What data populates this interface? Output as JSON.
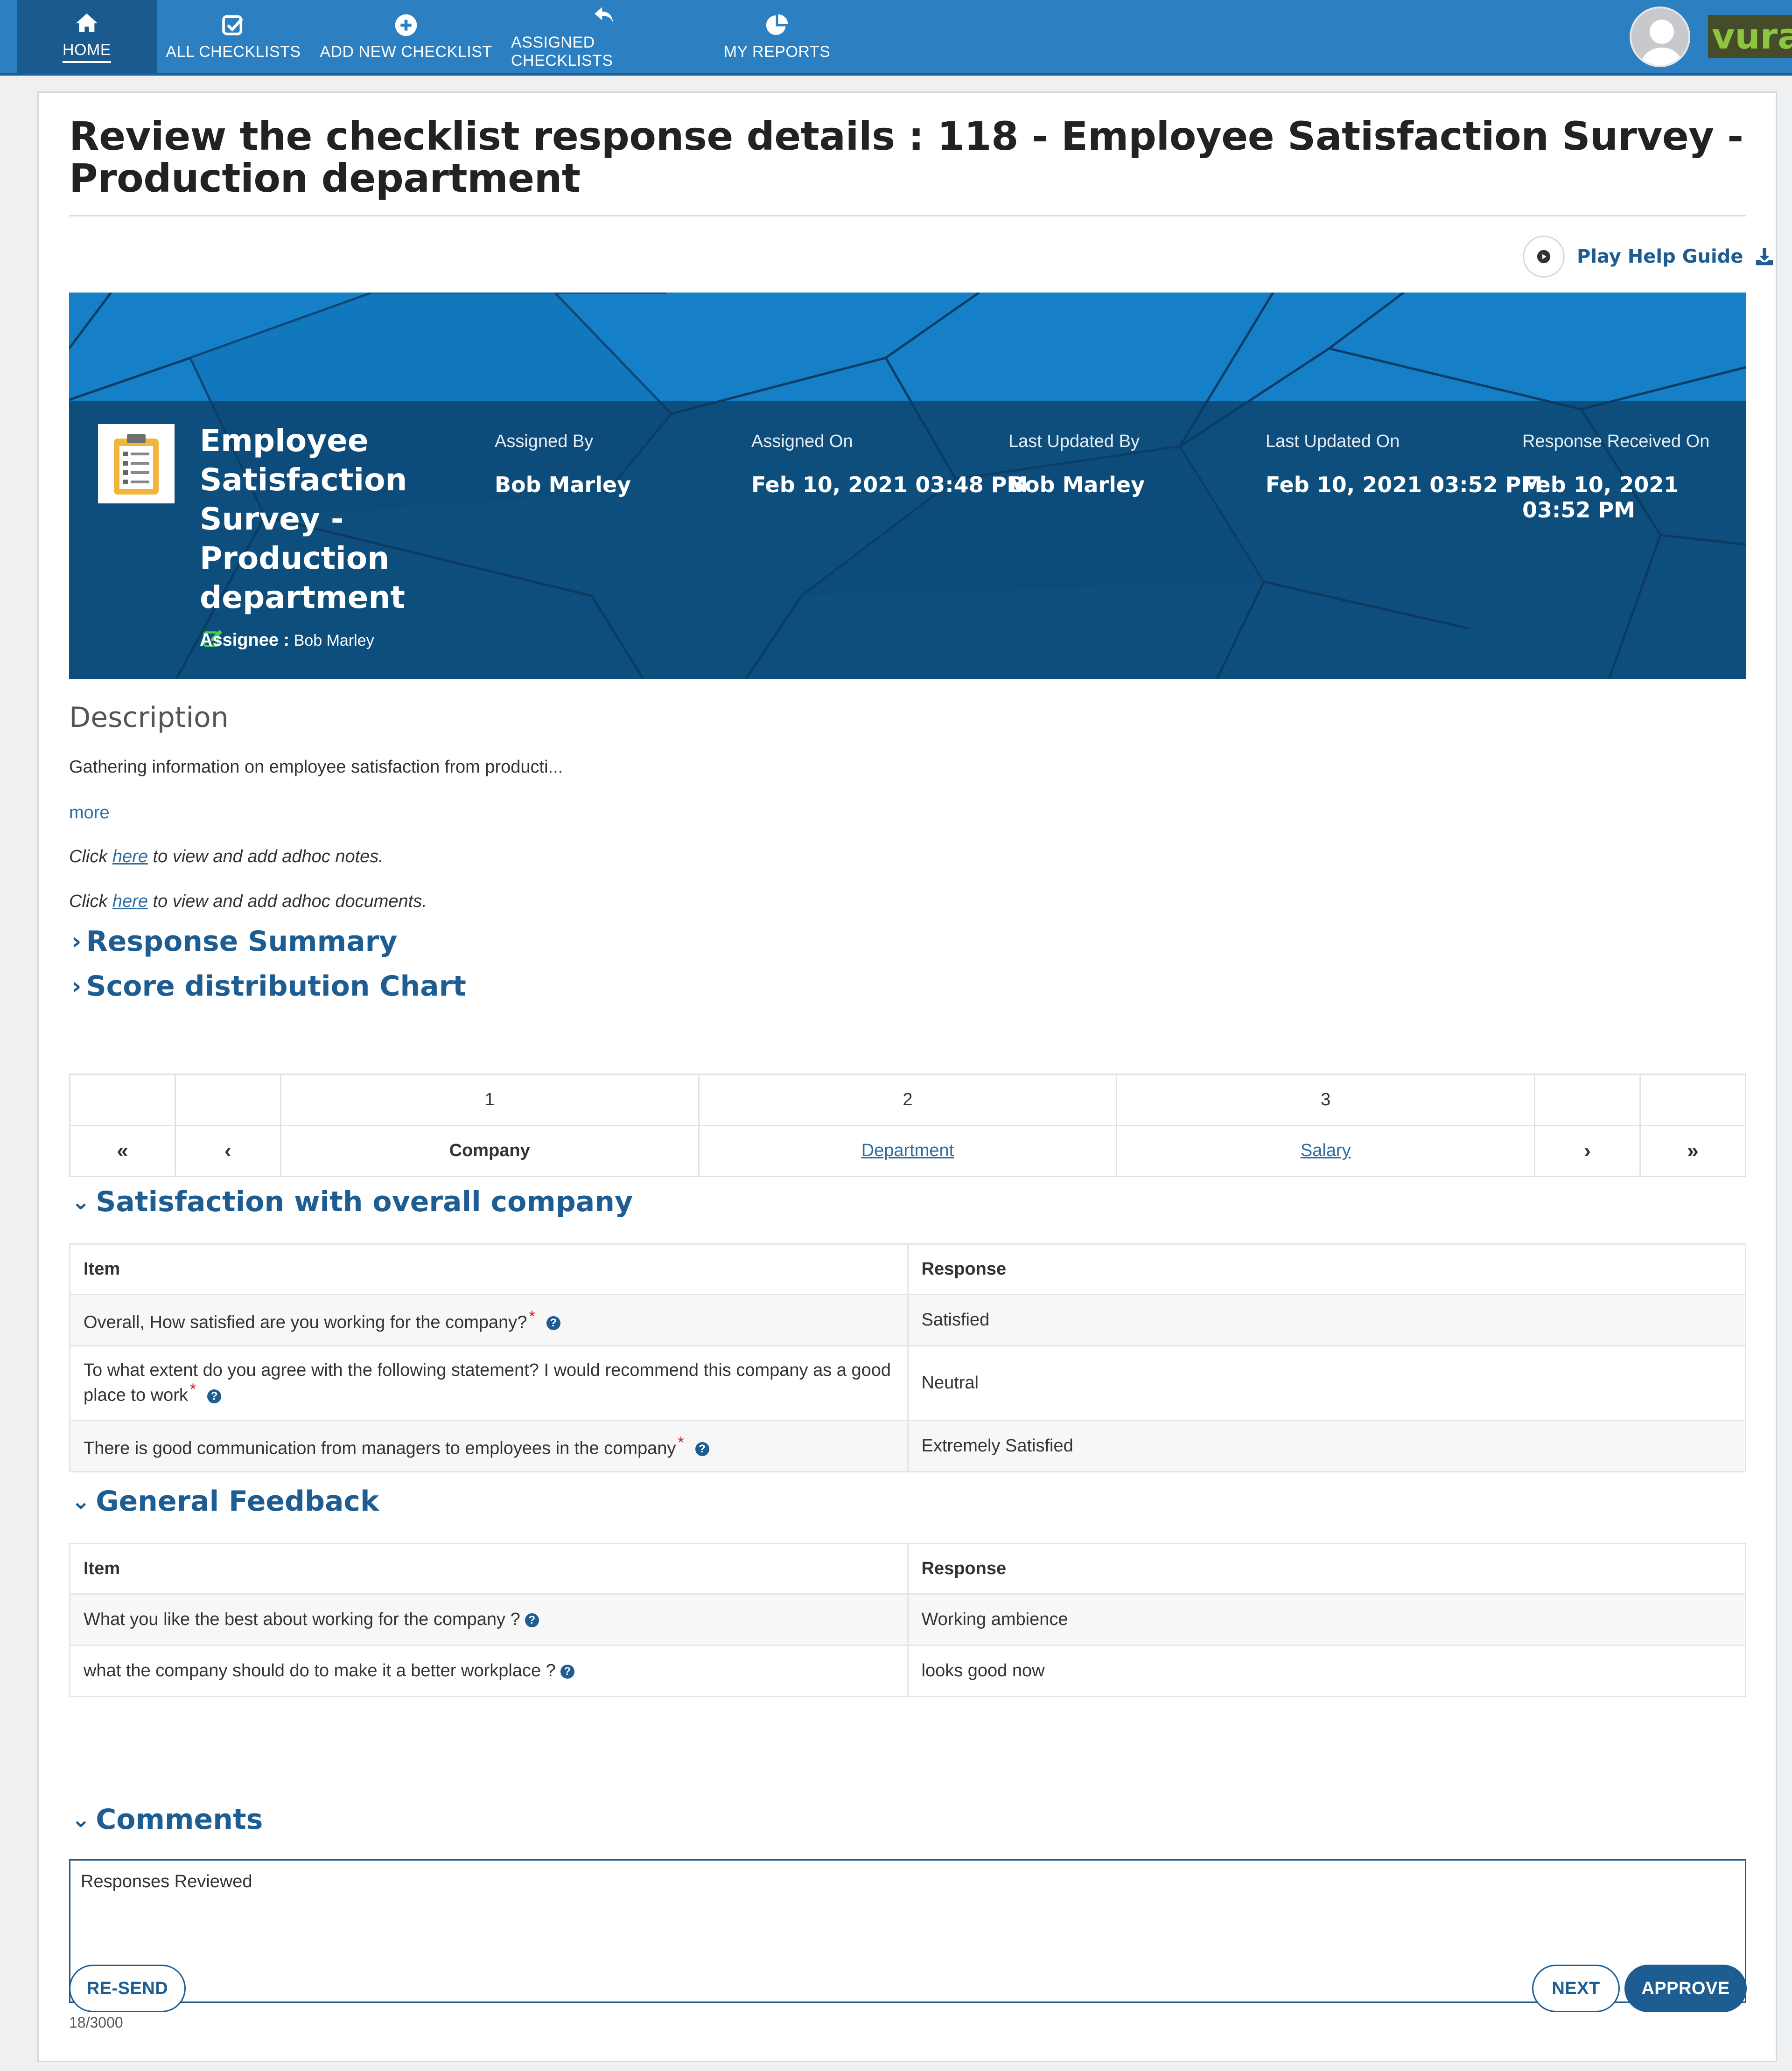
{
  "nav": {
    "items": [
      {
        "label": "HOME",
        "icon": "home-icon"
      },
      {
        "label": "ALL CHECKLISTS",
        "icon": "checkbox-icon"
      },
      {
        "label": "ADD NEW CHECKLIST",
        "icon": "plus-circle-icon"
      },
      {
        "label": "ASSIGNED CHECKLISTS",
        "icon": "reply-icon"
      },
      {
        "label": "MY REPORTS",
        "icon": "pie-chart-icon"
      }
    ],
    "logo_text": "vuram"
  },
  "page": {
    "title": "Review the checklist response details : 118 - Employee Satisfaction Survey - Production department",
    "help_guide": "Play Help Guide"
  },
  "banner": {
    "checklist_name": "Employee Satisfaction Survey - Production department",
    "assignee_label": "Assignee :",
    "assignee_value": "Bob Marley",
    "meta": [
      {
        "label": "Assigned By",
        "value": "Bob Marley"
      },
      {
        "label": "Assigned On",
        "value": "Feb 10, 2021 03:48 PM"
      },
      {
        "label": "Last Updated By",
        "value": "Bob Marley"
      },
      {
        "label": "Last Updated On",
        "value": "Feb 10, 2021 03:52 PM"
      },
      {
        "label": "Response Received On",
        "value": "Feb 10, 2021 03:52 PM"
      }
    ]
  },
  "description": {
    "heading": "Description",
    "text": "Gathering information on employee satisfaction from producti...",
    "more": "more",
    "notes_pre": "Click ",
    "notes_link": "here",
    "notes_post": " to view and add adhoc notes.",
    "docs_pre": "Click ",
    "docs_link": "here",
    "docs_post": " to view and add adhoc documents."
  },
  "sections_links": {
    "response_summary": "Response Summary",
    "score_chart": "Score distribution Chart"
  },
  "pager": {
    "numbers": [
      "1",
      "2",
      "3"
    ],
    "pages": [
      "Company",
      "Department",
      "Salary"
    ],
    "first": "«",
    "prev": "‹",
    "next": "›",
    "last": "»"
  },
  "groups": {
    "company": {
      "title": "Satisfaction with overall company",
      "col_item": "Item",
      "col_response": "Response",
      "rows": [
        {
          "q": "Overall, How satisfied are you working for the company?",
          "a": "Satisfied"
        },
        {
          "q": "To what extent do you agree with the following statement? I would recommend this company as a good place to work",
          "a": "Neutral"
        },
        {
          "q": "There is good communication from managers to employees in the company",
          "a": "Extremely Satisfied"
        }
      ]
    },
    "feedback": {
      "title": "General Feedback",
      "col_item": "Item",
      "col_response": "Response",
      "rows": [
        {
          "q": "What you like the best about working for the company ?",
          "a": "Working ambience"
        },
        {
          "q": "what the company should do to make it a better workplace ?",
          "a": "looks good now"
        }
      ]
    }
  },
  "comments": {
    "title": "Comments",
    "value": "Responses Reviewed",
    "count": "18/3000"
  },
  "buttons": {
    "resend": "RE-SEND",
    "next": "NEXT",
    "approve": "APPROVE"
  },
  "colors": {
    "nav": "#2c7fc0",
    "accent": "#1e5d91",
    "banner": "#1a86cf",
    "required": "#d42020"
  }
}
